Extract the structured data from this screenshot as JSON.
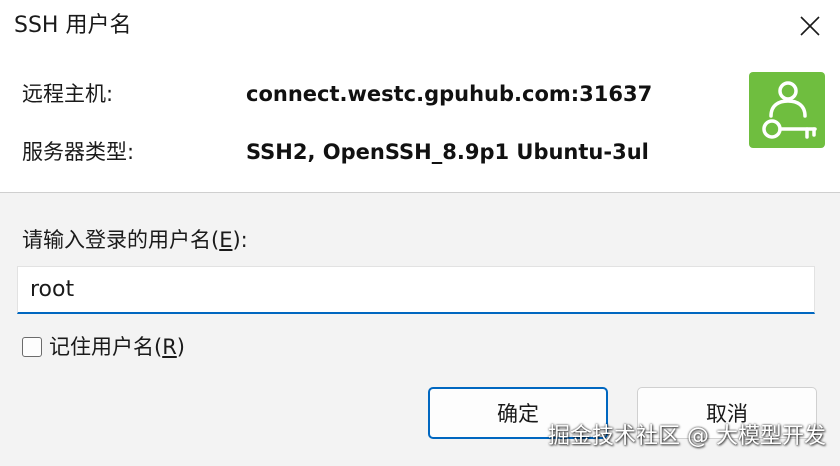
{
  "window": {
    "title": "SSH 用户名",
    "close_icon": "close-icon"
  },
  "info": {
    "host_label": "远程主机:",
    "host_value": "connect.westc.gpuhub.com:31637",
    "server_type_label": "服务器类型:",
    "server_type_value": "SSH2, OpenSSH_8.9p1 Ubuntu-3ul",
    "logo_icon": "user-key-icon",
    "logo_color": "#6fbe3f"
  },
  "prompt": {
    "label_prefix": "请输入登录的用户名(",
    "label_hotkey": "E",
    "label_suffix": "):"
  },
  "username": {
    "value": "root"
  },
  "remember": {
    "checked": false,
    "label_prefix": "记住用户名(",
    "label_hotkey": "R",
    "label_suffix": ")"
  },
  "buttons": {
    "ok_label": "确定",
    "cancel_label": "取消"
  },
  "watermark": {
    "text": "掘金技术社区 @ 大模型开发"
  },
  "colors": {
    "accent": "#0067c0",
    "background": "#f3f3f3"
  }
}
